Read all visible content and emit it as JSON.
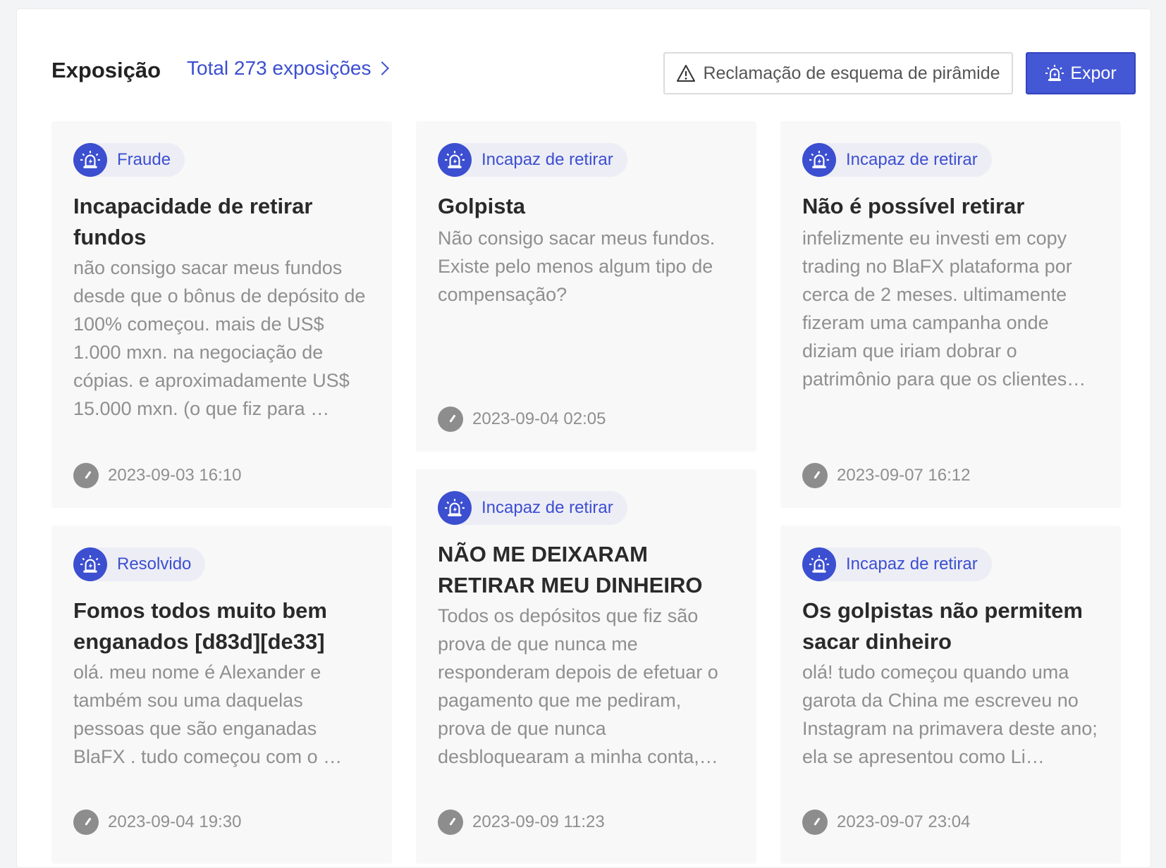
{
  "header": {
    "title": "Exposição",
    "total_link": "Total 273 exposições",
    "complain_button": "Reclamação de esquema de pirâmide",
    "expor_button": "Expor"
  },
  "colors": {
    "accent": "#3c4fd0",
    "card_bg": "#f8f8f8",
    "tag_bg": "#ededf6",
    "muted_text": "#8f8f8f"
  },
  "cards": [
    {
      "tag": "Fraude",
      "title": "Incapacidade de retirar fundos",
      "text": "não consigo sacar meus fundos desde que o bônus de depósito de 100% começou. mais de US$ 1.000 mxn. na negociação de cópias. e aproximadamente US$ 15.000 mxn. (o que fiz para …",
      "time": "2023-09-03 16:10"
    },
    {
      "tag": "Incapaz de retirar",
      "title": "Golpista",
      "text": "Não consigo sacar meus fundos. Existe pelo menos algum tipo de compensação?",
      "time": "2023-09-04 02:05"
    },
    {
      "tag": "Incapaz de retirar",
      "title": "Não é possível retirar",
      "text": "infelizmente eu investi em copy trading no BlaFX plataforma por cerca de 2 meses. ultimamente fizeram uma campanha onde diziam que iriam dobrar o patrimônio para que os clientes…",
      "time": "2023-09-07 16:12"
    },
    {
      "tag": "Resolvido",
      "title": "Fomos todos muito bem enganados [d83d][de33]",
      "text": "olá. meu nome é Alexander e também sou uma daquelas pessoas que são enganadas BlaFX . tudo começou com o …",
      "time": "2023-09-04 19:30"
    },
    {
      "tag": "Incapaz de retirar",
      "title": "NÃO ME DEIXARAM RETIRAR MEU DINHEIRO",
      "text": "Todos os depósitos que fiz são prova de que nunca me responderam depois de efetuar o pagamento que me pediram, prova de que nunca desbloquearam a minha conta,…",
      "time": "2023-09-09 11:23"
    },
    {
      "tag": "Incapaz de retirar",
      "title": "Os golpistas não permitem sacar dinheiro",
      "text": "olá! tudo começou quando uma garota da China me escreveu no Instagram na primavera deste ano; ela se apresentou como Li…",
      "time": "2023-09-07 23:04"
    }
  ]
}
